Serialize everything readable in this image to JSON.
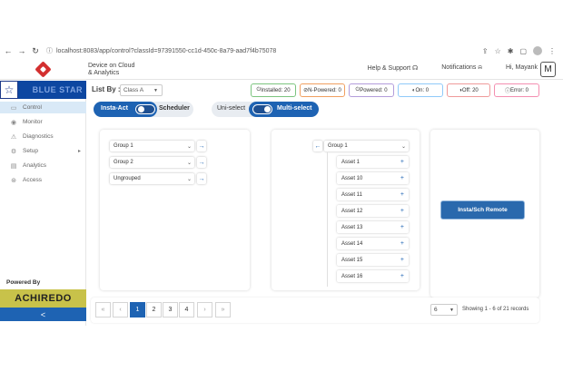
{
  "browser": {
    "url": "localhost:8083/app/control?classId=97391550-cc1d-450c-8a79-aad7f4b75078",
    "back_icon": "arrow-left-icon",
    "forward_icon": "arrow-right-icon",
    "reload_icon": "reload-icon"
  },
  "header": {
    "title_line1": "Device on Cloud",
    "title_line2": "& Analytics",
    "help": "Help & Support",
    "notifications": "Notifications",
    "user_greeting": "Hi, Mayank",
    "user_initial": "M"
  },
  "sidebar": {
    "brand": "BLUE STAR",
    "items": [
      {
        "label": "Control",
        "icon": "monitor-icon"
      },
      {
        "label": "Monitor",
        "icon": "eye-icon"
      },
      {
        "label": "Diagnostics",
        "icon": "warning-icon"
      },
      {
        "label": "Setup",
        "icon": "gear-icon"
      },
      {
        "label": "Analytics",
        "icon": "chart-icon"
      },
      {
        "label": "Access",
        "icon": "access-icon"
      }
    ],
    "powered_by": "Powered By",
    "powered_brand": "ACHIREDO",
    "collapse_glyph": "<"
  },
  "main": {
    "list_by_label": "List By :",
    "class_value": "Class A",
    "status": {
      "installed": "Installed: 20",
      "n_powered": "N-Powered: 0",
      "powered": "Powered: 0",
      "on": "On: 0",
      "off": "Off: 20",
      "error": "Error: 0"
    },
    "toggles": {
      "insta_act": "Insta-Act",
      "scheduler": "Scheduler",
      "uni_select": "Uni-select",
      "multi_select": "Multi-select"
    },
    "left_groups": [
      "Group 1",
      "Group 2",
      "Ungrouped"
    ],
    "right_group": "Group 1",
    "assets": [
      "Asset 1",
      "Asset 10",
      "Asset 11",
      "Asset 12",
      "Asset 13",
      "Asset 14",
      "Asset 15",
      "Asset 16"
    ],
    "remote_button": "Insta/Sch Remote"
  },
  "pagination": {
    "first": "«",
    "prev": "‹",
    "pages": [
      "1",
      "2",
      "3",
      "4"
    ],
    "next": "›",
    "last": "»",
    "page_size": "6",
    "showing": "Showing 1 - 6 of 21 records"
  },
  "colors": {
    "primary": "#1e63b3",
    "brand_blue": "#0d47a1",
    "achiredo": "#c8c24a",
    "installed_border": "#7cc47f",
    "n_powered_border": "#f0a060",
    "powered_border": "#b39ddb",
    "on_border": "#90caf9",
    "off_border": "#ef9a9a",
    "error_border": "#f48fb1"
  }
}
